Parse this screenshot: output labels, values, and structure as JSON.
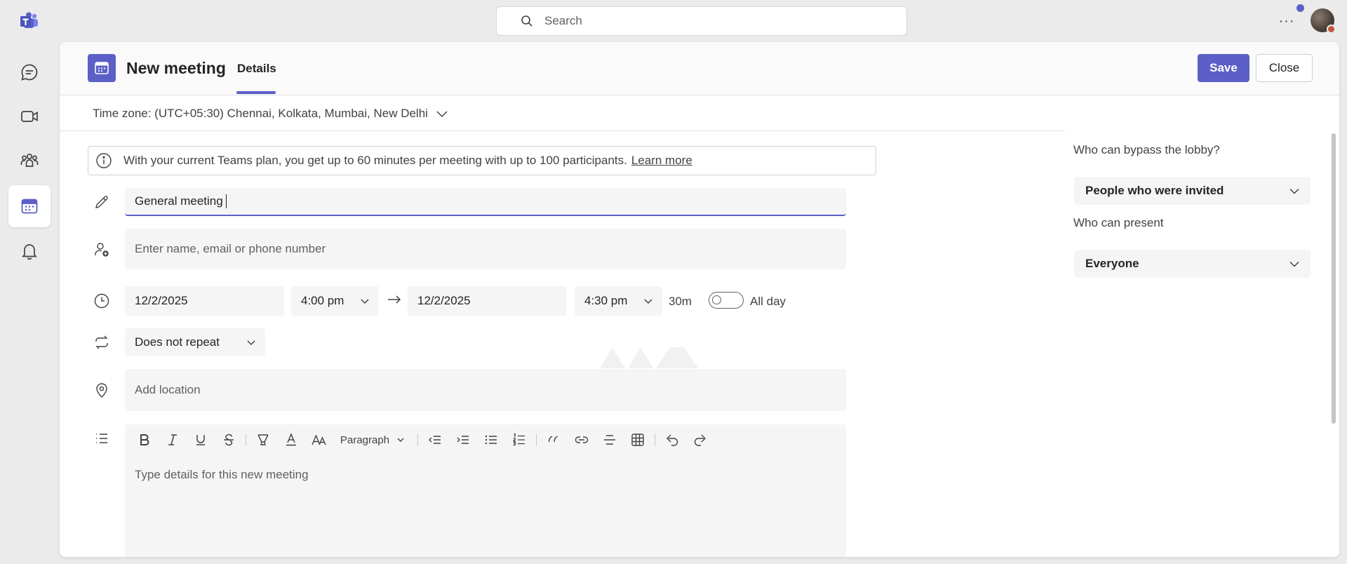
{
  "colors": {
    "brand": "#5b5fc7",
    "background": "#ebebeb",
    "panel": "#ffffff",
    "field": "#f5f5f5"
  },
  "topbar": {
    "search_placeholder": "Search",
    "more_label": "···"
  },
  "rail": {
    "items": [
      "chat-icon",
      "video-icon",
      "teams-icon",
      "calendar-icon",
      "bell-icon"
    ],
    "active": "calendar-icon"
  },
  "header": {
    "title": "New meeting",
    "tab": "Details",
    "save_label": "Save",
    "close_label": "Close"
  },
  "timezone": {
    "label": "Time zone: (UTC+05:30) Chennai, Kolkata, Mumbai, New Delhi"
  },
  "banner": {
    "text": "With your current Teams plan, you get up to 60 minutes per meeting with up to 100 participants.",
    "link": "Learn more"
  },
  "form": {
    "title_value": "General meeting",
    "attendees_placeholder": "Enter name, email or phone number",
    "start_date": "12/2/2025",
    "start_time": "4:00 pm",
    "end_date": "12/2/2025",
    "end_time": "4:30 pm",
    "duration": "30m",
    "all_day_label": "All day",
    "all_day_on": false,
    "repeat": "Does not repeat",
    "location_placeholder": "Add location",
    "details_placeholder": "Type details for this new meeting"
  },
  "editor_toolbar": {
    "paragraph_label": "Paragraph"
  },
  "options": {
    "lobby_label": "Who can bypass the lobby?",
    "lobby_value": "People who were invited",
    "present_label": "Who can present",
    "present_value": "Everyone"
  }
}
